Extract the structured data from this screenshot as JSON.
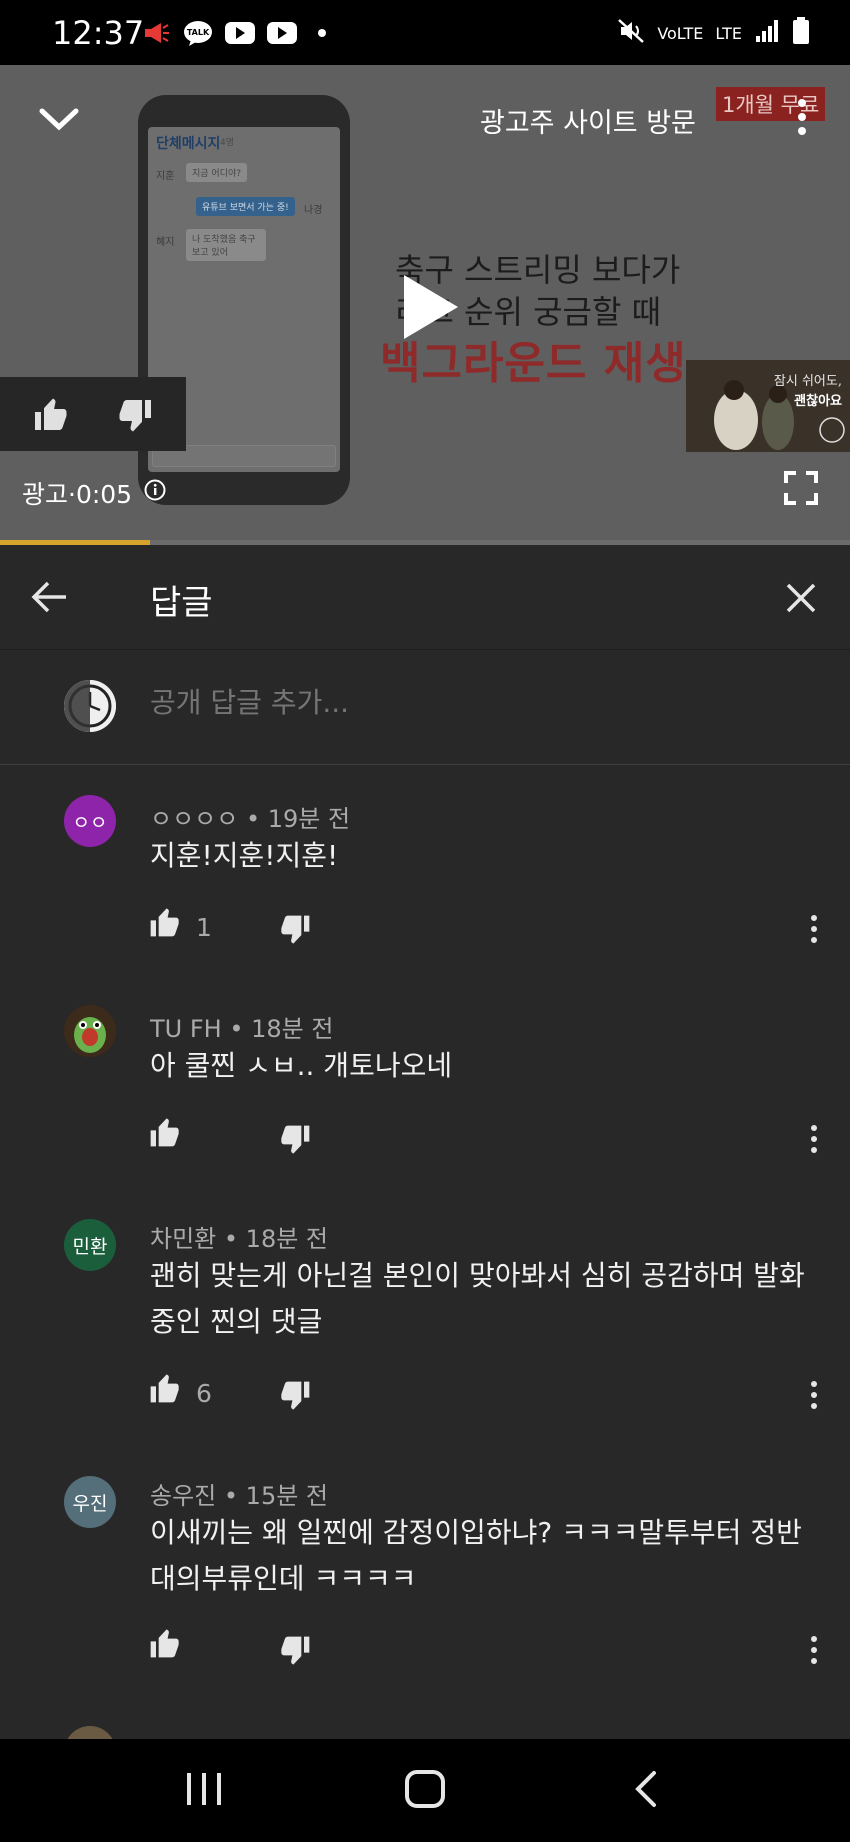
{
  "status_bar": {
    "time": "12:37",
    "kakao_label": "TALK",
    "volte_label": "VoLTE",
    "lte_label": "LTE"
  },
  "video": {
    "visit_label": "광고주 사이트 방문",
    "promo_badge": "1개월 무료",
    "ad_line1": "축구 스트리밍 보다가",
    "ad_line2": "리그 순위 궁금할 때",
    "ad_line3": "백그라운드 재생",
    "phone_title": "단체메시지",
    "phone_title_sub": "4명",
    "phone_name1": "지훈",
    "phone_bubble1": "지금 어디야?",
    "phone_bubble2": "유튜브 보면서 가는 중!",
    "phone_name2": "나경",
    "phone_name3": "혜지",
    "phone_bubble3": "나 도착했음 축구 보고 있어",
    "ad_thumb_line1": "잠시 쉬어도,",
    "ad_thumb_line2": "괜찮아요",
    "ad_time": "광고·0:05",
    "progress": 0.177
  },
  "replies": {
    "title": "답글",
    "add_placeholder": "공개 답글 추가..."
  },
  "comments": [
    {
      "author": "ㅇㅇㅇㅇ",
      "time": "19분 전",
      "text": "지훈!지훈!지훈!",
      "likes": "1",
      "avatar_text": "ㅇㅇ",
      "avatar_color": "#8e24aa"
    },
    {
      "author": "TU FH",
      "time": "18분 전",
      "text": "아 쿨찐 ㅅㅂ.. 개토나오네",
      "likes": "",
      "avatar_text": "",
      "avatar_color": "#3c2a1a"
    },
    {
      "author": "차민환",
      "time": "18분 전",
      "text": "괜히 맞는게 아닌걸 본인이 맞아봐서 심히 공감하며 발화중인 찐의 댓글",
      "likes": "6",
      "avatar_text": "민환",
      "avatar_color": "#1b5e3c"
    },
    {
      "author": "송우진",
      "time": "15분 전",
      "text": "이새끼는 왜 일찐에 감정이입하냐? ㅋㅋㅋ말투부터 정반대의부류인데 ㅋㅋㅋㅋ",
      "likes": "",
      "avatar_text": "우진",
      "avatar_color": "#546e7a"
    }
  ],
  "colors": {
    "background": "#282828",
    "accent_progress": "#d6a32b",
    "promo_red": "#8a2320"
  }
}
